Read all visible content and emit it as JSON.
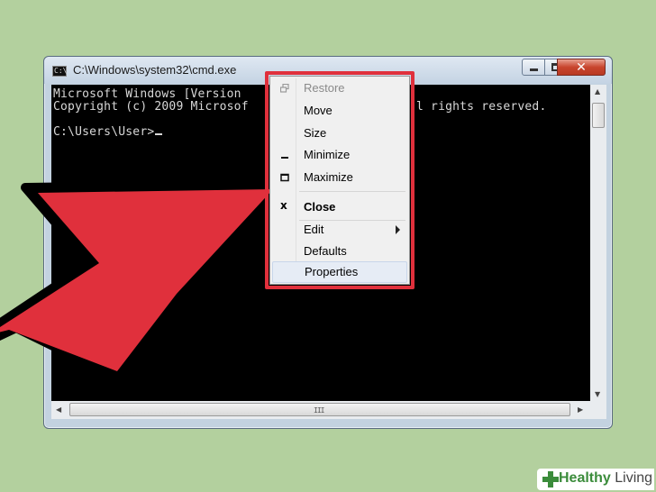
{
  "window": {
    "title": "C:\\Windows\\system32\\cmd.exe",
    "icon_text": "C:\\",
    "close_glyph": "✕"
  },
  "console": {
    "line1": "Microsoft Windows [Version",
    "line2": "Copyright (c) 2009 Microsof",
    "line2_tail": "l rights reserved.",
    "prompt": "C:\\Users\\User>"
  },
  "context_menu": {
    "items": [
      {
        "label": "Restore",
        "icon": "restore-icon",
        "disabled": true
      },
      {
        "label": "Move",
        "icon": null
      },
      {
        "label": "Size",
        "icon": null
      },
      {
        "label": "Minimize",
        "icon": "minimize-icon"
      },
      {
        "label": "Maximize",
        "icon": "maximize-icon"
      },
      {
        "label": "Close",
        "icon": "close-icon",
        "bold": true
      },
      {
        "label": "Edit",
        "submenu": true
      },
      {
        "label": "Defaults"
      },
      {
        "label": "Properties",
        "highlighted": true
      }
    ],
    "close_glyph": "x"
  },
  "scrollbar": {
    "grip": "III"
  },
  "watermark": {
    "brand_part1": "Healthy",
    "brand_part2": "Living"
  },
  "colors": {
    "highlight_outline": "#e0303c",
    "arrow": "#e0303c",
    "background": "#b3d09e"
  }
}
